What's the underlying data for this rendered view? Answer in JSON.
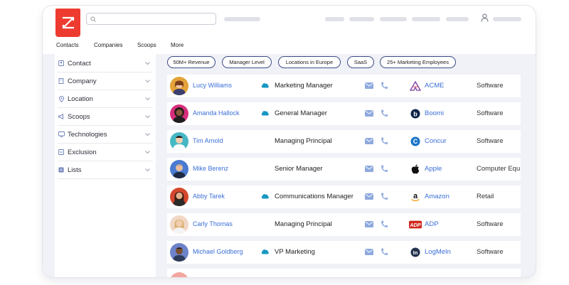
{
  "search": {
    "placeholder": ""
  },
  "nav_tabs": [
    "Contacts",
    "Companies",
    "Scoops",
    "More"
  ],
  "filters": [
    "Contact",
    "Company",
    "Location",
    "Scoops",
    "Technologies",
    "Exclusion",
    "Lists"
  ],
  "chips": [
    "50M+ Revenue",
    "Manager Level",
    "Locations in Europe",
    "SaaS",
    "25+ Marketing Employees"
  ],
  "contacts": [
    {
      "name": "Lucy Williams",
      "title": "Marketing Manager",
      "company": "ACME",
      "industry": "Software",
      "salesforce": true
    },
    {
      "name": "Amanda Hallock",
      "title": "General Manager",
      "company": "Boomi",
      "industry": "Software",
      "salesforce": true
    },
    {
      "name": "Tim Arnold",
      "title": "Managing Principal",
      "company": "Concur",
      "industry": "Software",
      "salesforce": false
    },
    {
      "name": "Mike Berenz",
      "title": "Senior Manager",
      "company": "Apple",
      "industry": "Computer Equ",
      "salesforce": false
    },
    {
      "name": "Abby Tarek",
      "title": "Communications Manager",
      "company": "Amazon",
      "industry": "Retail",
      "salesforce": true
    },
    {
      "name": "Carly Thomas",
      "title": "Managing Principal",
      "company": "ADP",
      "industry": "Software",
      "salesforce": false
    },
    {
      "name": "Michael Goldberg",
      "title": "VP Marketing",
      "company": "LogMeIn",
      "industry": "Software",
      "salesforce": true
    }
  ],
  "colors": {
    "brand": "#ee3b30",
    "link": "#3b6fd8",
    "icon": "#8ea9de",
    "chip_border": "#3d4b88",
    "salesforce": "#1798c1"
  }
}
